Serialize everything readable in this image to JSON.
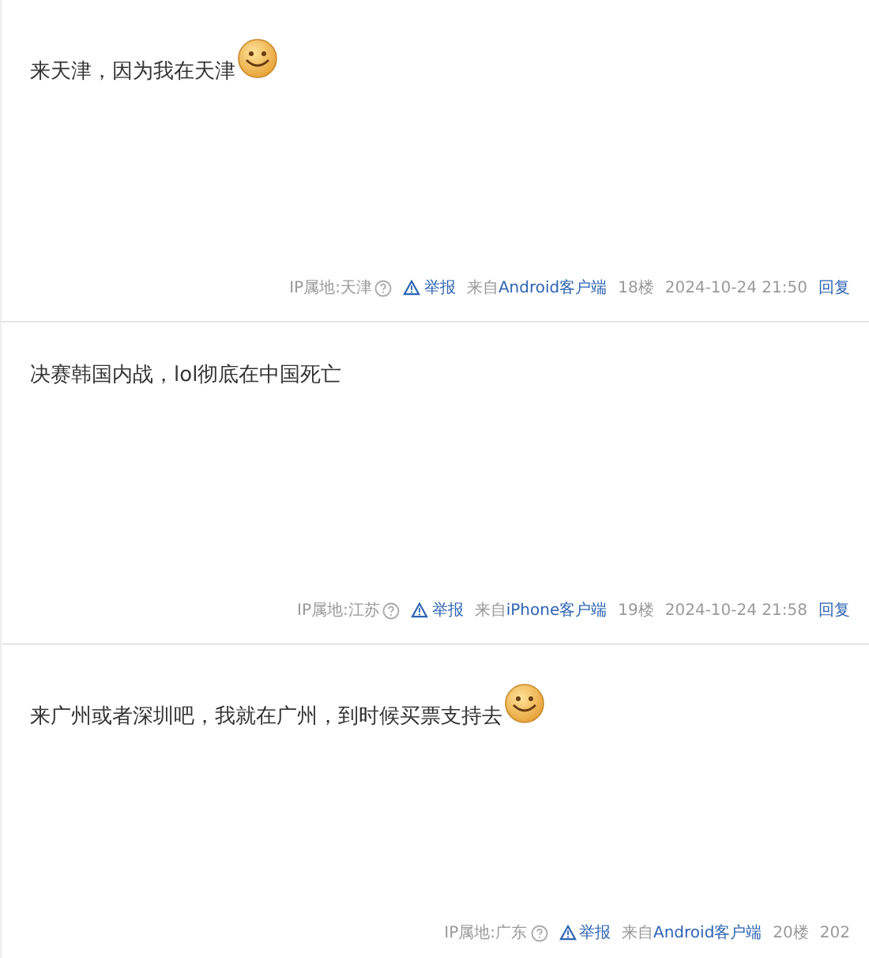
{
  "posts": [
    {
      "text": "来天津，因为我在天津",
      "emoji": true,
      "ip": "IP属地:天津",
      "report": "举报",
      "source_prefix": "来自",
      "source": "Android客户端",
      "floor": "18楼",
      "time": "2024-10-24 21:50",
      "reply": "回复"
    },
    {
      "text": "决赛韩国内战，lol彻底在中国死亡",
      "emoji": false,
      "ip": "IP属地:江苏",
      "report": "举报",
      "source_prefix": "来自",
      "source": "iPhone客户端",
      "floor": "19楼",
      "time": "2024-10-24 21:58",
      "reply": "回复"
    },
    {
      "text": "来广州或者深圳吧，我就在广州，到时候买票支持去",
      "emoji": true,
      "ip": "IP属地:广东",
      "report": "举报",
      "source_prefix": "来自",
      "source": "Android客户端",
      "floor": "20楼",
      "time": "202"
    }
  ]
}
